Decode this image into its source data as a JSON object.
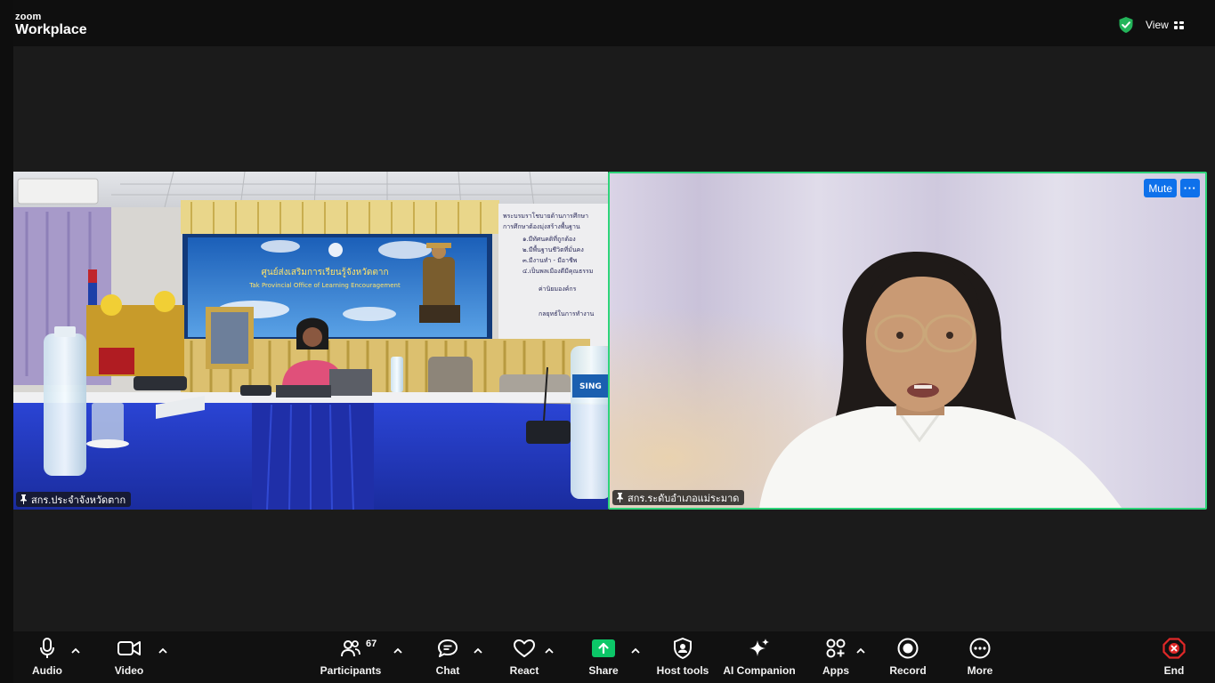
{
  "app": {
    "brand_small": "zoom",
    "brand_large": "Workplace",
    "view_label": "View"
  },
  "participants": {
    "left": {
      "name": "สกร.ประจำจังหวัดตาก"
    },
    "right": {
      "name": "สกร.ระดับอำเภอแม่ระมาด",
      "mute_label": "Mute",
      "more_label": "···"
    }
  },
  "scene": {
    "banner_thai": "ศูนย์ส่งเสริมการเรียนรู้จังหวัดตาก",
    "banner_en": "Tak Provincial Office of Learning Encouragement",
    "board_lines": [
      "พระบรมราโชบายด้านการศึกษา",
      "การศึกษาต้องมุ่งสร้างพื้นฐาน",
      "๑.มีทัศนคติที่ถูกต้อง",
      "๒.มีพื้นฐานชีวิตที่มั่นคง",
      "๓.มีงานทำ - มีอาชีพ",
      "๔.เป็นพลเมืองดีมีคุณธรรม",
      "ค่านิยมองค์กร",
      "กลยุทธ์ในการทำงาน"
    ],
    "bottle_brand": "SING"
  },
  "toolbar": {
    "audio": "Audio",
    "video": "Video",
    "participants": "Participants",
    "participant_count": "67",
    "chat": "Chat",
    "react": "React",
    "share": "Share",
    "host_tools": "Host tools",
    "ai_companion": "AI Companion",
    "apps": "Apps",
    "record": "Record",
    "more": "More",
    "end": "End"
  },
  "colors": {
    "accent_blue": "#0e71eb",
    "active_speaker": "#2ed47a",
    "share_green": "#0cc768",
    "end_red": "#e02828"
  }
}
